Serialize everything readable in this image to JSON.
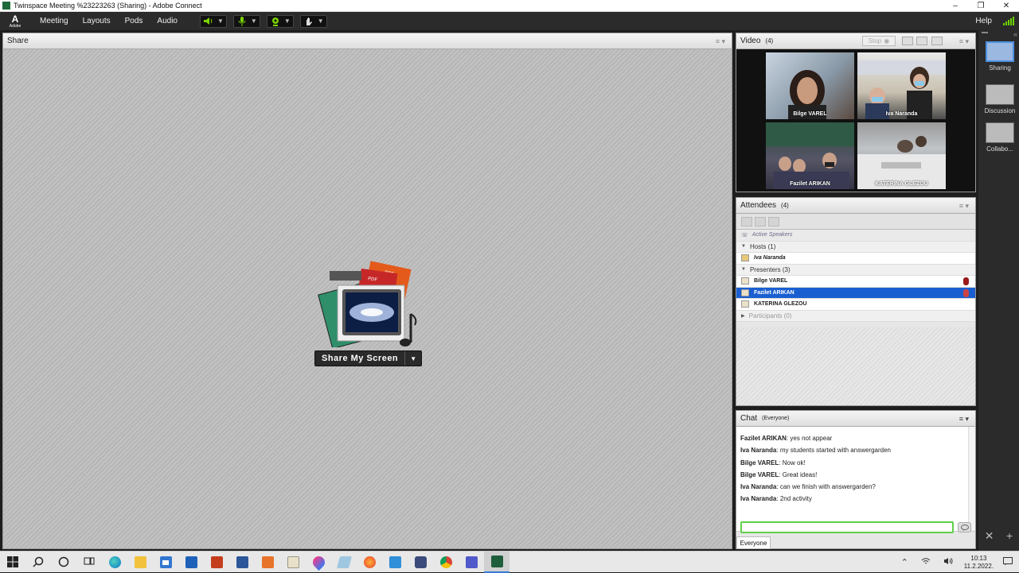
{
  "window": {
    "title": "Twinspace Meeting %23223263 (Sharing) - Adobe Connect",
    "minimize": "–",
    "restore": "❐",
    "close": "✕"
  },
  "menubar": {
    "logo_letter": "A",
    "logo_text": "Adobe",
    "items": [
      "Meeting",
      "Layouts",
      "Pods",
      "Audio"
    ],
    "help": "Help"
  },
  "share_pod": {
    "title": "Share",
    "menu_icon": "≡ ▾",
    "share_button": "Share My Screen",
    "dropdown": "▼",
    "illus_ppt": "PPT",
    "illus_pdf": "PDF"
  },
  "video_pod": {
    "title": "Video",
    "count": "(4)",
    "stop": "Stop",
    "menu_icon": "≡ ▾",
    "tiles": [
      {
        "name": "Bilge  VAREL"
      },
      {
        "name": "Iva Naranda"
      },
      {
        "name": "Fazilet ARIKAN"
      },
      {
        "name": "KATERINA GLEZOU"
      }
    ]
  },
  "attendees_pod": {
    "title": "Attendees",
    "count": "(4)",
    "menu_icon": "≡ ▾",
    "active_speakers": "Active Speakers",
    "hosts_label": "Hosts (1)",
    "hosts": [
      "Iva Naranda"
    ],
    "presenters_label": "Presenters (3)",
    "presenters": [
      "Bilge  VAREL",
      "Fazilet ARIKAN",
      "KATERINA GLEZOU"
    ],
    "participants_label": "Participants (0)"
  },
  "chat_pod": {
    "title": "Chat",
    "scope": "(Everyone)",
    "menu_icon": "≡ ▾",
    "messages": [
      {
        "sender": "Fazilet ARIKAN",
        "text": " yes not appear"
      },
      {
        "sender": "Iva Naranda",
        "text": " my students started with answergarden"
      },
      {
        "sender": "Bilge  VAREL",
        "text": " Now ok!"
      },
      {
        "sender": "Bilge  VAREL",
        "text": " Great ideas!"
      },
      {
        "sender": "Iva Naranda",
        "text": " can we finish with answergarden?"
      },
      {
        "sender": "Iva Naranda",
        "text": " 2nd activity"
      }
    ],
    "input_value": "",
    "tab": "Everyone"
  },
  "layouts_bar": {
    "items": [
      "Sharing",
      "Discussion",
      "Collabo..."
    ],
    "close": "✕",
    "add": "+"
  },
  "taskbar": {
    "time": "10:13",
    "date": "11.2.2022."
  }
}
